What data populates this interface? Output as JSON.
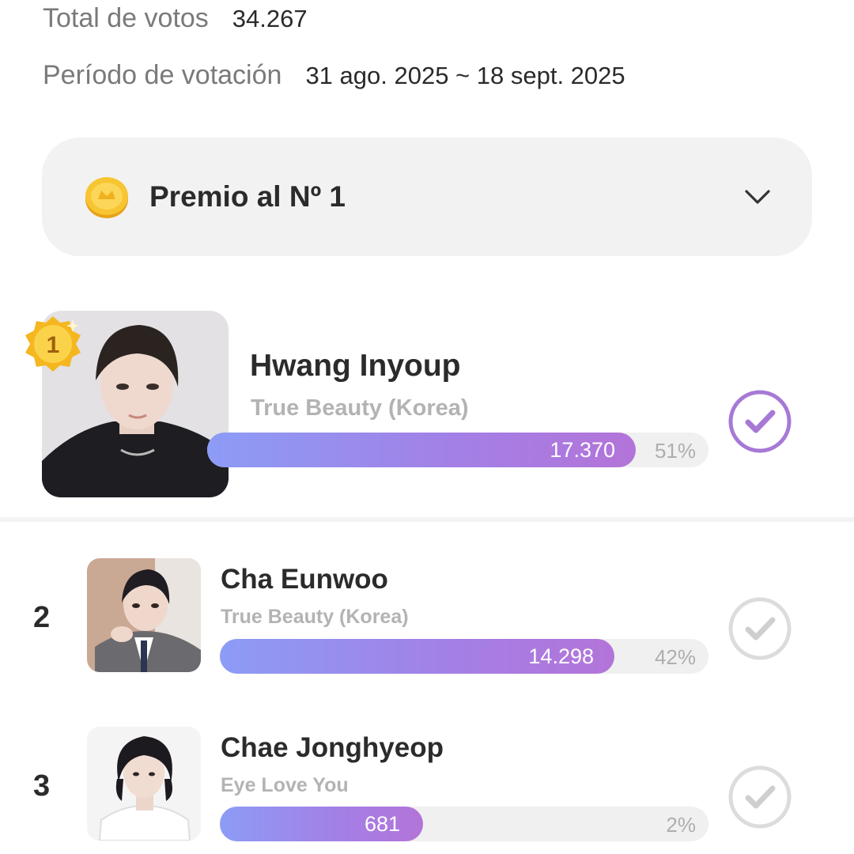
{
  "stats": {
    "total_label": "Total de votos",
    "total_value": "34.267",
    "period_label": "Período de votación",
    "period_value": "31 ago. 2025 ~ 18 sept. 2025"
  },
  "prize": {
    "title": "Premio al Nº 1",
    "icon": "gold-coin-icon",
    "expand_icon": "chevron-down-icon"
  },
  "candidates": [
    {
      "rank": "1",
      "name": "Hwang Inyoup",
      "group": "True Beauty (Korea)",
      "votes": "17.370",
      "percent": "51%",
      "share": 0.51,
      "voted": true
    },
    {
      "rank": "2",
      "name": "Cha Eunwoo",
      "group": "True Beauty (Korea)",
      "votes": "14.298",
      "percent": "42%",
      "share": 0.42,
      "voted": false
    },
    {
      "rank": "3",
      "name": "Chae Jonghyeop",
      "group": "Eye Love You",
      "votes": "681",
      "percent": "2%",
      "share": 0.02,
      "voted": false
    }
  ],
  "colors": {
    "accent": "#a47fe5",
    "bar_start": "#8c9cf6",
    "bar_end": "#b374d9",
    "vote_active": "#a779d6",
    "vote_inactive": "#d9d9d9"
  }
}
